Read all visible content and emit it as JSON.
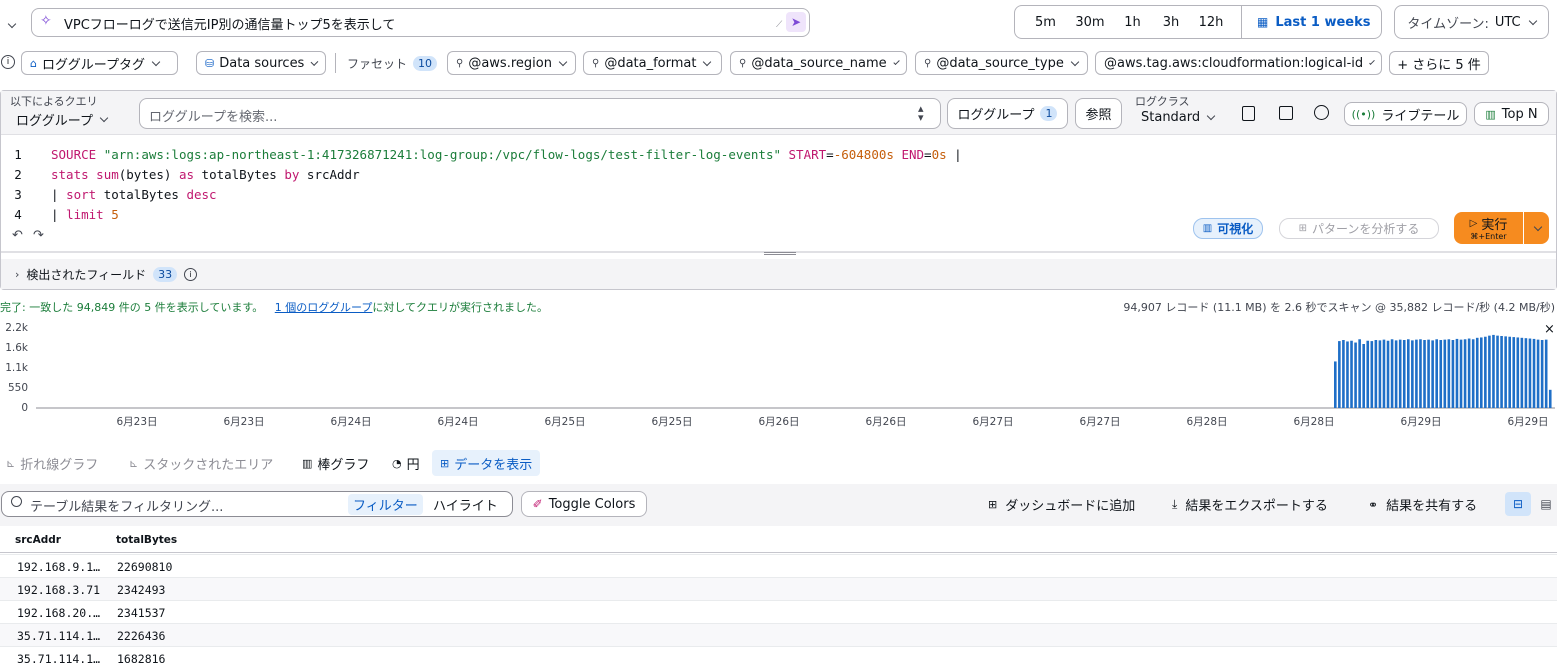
{
  "query_prompt": {
    "text": "VPCフローログで送信元IP別の通信量トップ5を表示して"
  },
  "time_range": {
    "options": [
      "5m",
      "30m",
      "1h",
      "3h",
      "12h"
    ],
    "selected_label": "Last 1 weeks",
    "timezone_label": "タイムゾーン:",
    "timezone_value": "UTC"
  },
  "filters": {
    "log_group_tags": "ロググループタグ",
    "data_sources": "Data sources",
    "facets_label": "ファセット",
    "facets_count": "10",
    "chips": [
      "@aws.region",
      "@data_format",
      "@data_source_name",
      "@data_source_type"
    ],
    "cf_chip": "@aws.tag.aws:cloudformation:logical-id",
    "more": "+ さらに 5 件"
  },
  "query_bar": {
    "by_label": "以下によるクエリ",
    "by_value": "ロググループ",
    "search_placeholder": "ロググループを検索...",
    "log_group_button": "ロググループ",
    "log_group_count": "1",
    "browse": "参照",
    "log_class_label": "ログクラス",
    "log_class_value": "Standard",
    "live_tail": "ライブテール",
    "top_n": "Top N"
  },
  "editor": {
    "lines": [
      {
        "n": "1",
        "tokens": [
          [
            "kw",
            "SOURCE "
          ],
          [
            "str",
            "\"arn:aws:logs:ap-northeast-1:417326871241:log-group:/vpc/flow-logs/test-filter-log-events\""
          ],
          [
            "txt",
            " "
          ],
          [
            "kw",
            "START"
          ],
          [
            "txt",
            "="
          ],
          [
            "num",
            "-604800s"
          ],
          [
            "txt",
            " "
          ],
          [
            "kw",
            "END"
          ],
          [
            "txt",
            "="
          ],
          [
            "num",
            "0s"
          ],
          [
            "txt",
            " |"
          ]
        ]
      },
      {
        "n": "2",
        "tokens": [
          [
            "kw",
            "stats"
          ],
          [
            "txt",
            " "
          ],
          [
            "fn",
            "sum"
          ],
          [
            "txt",
            "(bytes) "
          ],
          [
            "kw",
            "as"
          ],
          [
            "txt",
            " totalBytes "
          ],
          [
            "kw",
            "by"
          ],
          [
            "txt",
            " srcAddr"
          ]
        ]
      },
      {
        "n": "3",
        "tokens": [
          [
            "txt",
            "| "
          ],
          [
            "kw",
            "sort"
          ],
          [
            "txt",
            " totalBytes "
          ],
          [
            "kw",
            "desc"
          ]
        ]
      },
      {
        "n": "4",
        "tokens": [
          [
            "txt",
            "| "
          ],
          [
            "kw",
            "limit"
          ],
          [
            "txt",
            " "
          ],
          [
            "num",
            "5"
          ]
        ]
      }
    ],
    "visualize": "可視化",
    "analyze_patterns": "パターンを分析する",
    "run": "実行",
    "run_shortcut": "⌘+Enter"
  },
  "fields": {
    "label": "検出されたフィールド",
    "count": "33"
  },
  "status": {
    "prefix": "完了:",
    "text": "一致した 94,849 件の 5 件を表示しています。",
    "link": "1 個のロググループ",
    "suffix": "に対してクエリが実行されました。",
    "scan": "94,907 レコード (11.1 MB) を 2.6 秒でスキャン @ 35,882 レコード/秒 (4.2 MB/秒)"
  },
  "chart_data": {
    "type": "bar",
    "title": "",
    "xlabel": "",
    "ylabel": "",
    "ylim": [
      0,
      2200
    ],
    "yticks": [
      "2.2k",
      "1.6k",
      "1.1k",
      "550",
      "0"
    ],
    "xticks": [
      "6月23日",
      "6月23日",
      "6月24日",
      "6月24日",
      "6月25日",
      "6月25日",
      "6月26日",
      "6月26日",
      "6月27日",
      "6月27日",
      "6月28日",
      "6月28日",
      "6月29日",
      "6月29日"
    ],
    "color": "#1f6fc7",
    "values": [
      1280,
      1840,
      1870,
      1830,
      1850,
      1800,
      1890,
      1760,
      1850,
      1840,
      1870,
      1860,
      1880,
      1850,
      1890,
      1860,
      1880,
      1870,
      1890,
      1860,
      1880,
      1890,
      1870,
      1880,
      1860,
      1890,
      1870,
      1880,
      1890,
      1870,
      1900,
      1880,
      1890,
      1910,
      1890,
      1930,
      1940,
      1960,
      1990,
      2010,
      1990,
      1980,
      1970,
      1960,
      1950,
      1940,
      1930,
      1920,
      1910,
      1900,
      1880,
      1870,
      1880,
      500
    ]
  },
  "viz_tabs": {
    "line": "折れ線グラフ",
    "stacked": "スタックされたエリア",
    "bar": "棒グラフ",
    "pie": "円",
    "data": "データを表示"
  },
  "results_toolbar": {
    "filter_placeholder": "テーブル結果をフィルタリング...",
    "filter": "フィルター",
    "highlight": "ハイライト",
    "toggle_colors": "Toggle Colors",
    "add_dashboard": "ダッシュボードに追加",
    "export": "結果をエクスポートする",
    "share": "結果を共有する"
  },
  "table": {
    "columns": [
      "srcAddr",
      "totalBytes"
    ],
    "rows": [
      [
        "192.168.9.1…",
        "22690810"
      ],
      [
        "192.168.3.71",
        "2342493"
      ],
      [
        "192.168.20.…",
        "2341537"
      ],
      [
        "35.71.114.1…",
        "2226436"
      ],
      [
        "35.71.114.1…",
        "1682816"
      ]
    ]
  }
}
